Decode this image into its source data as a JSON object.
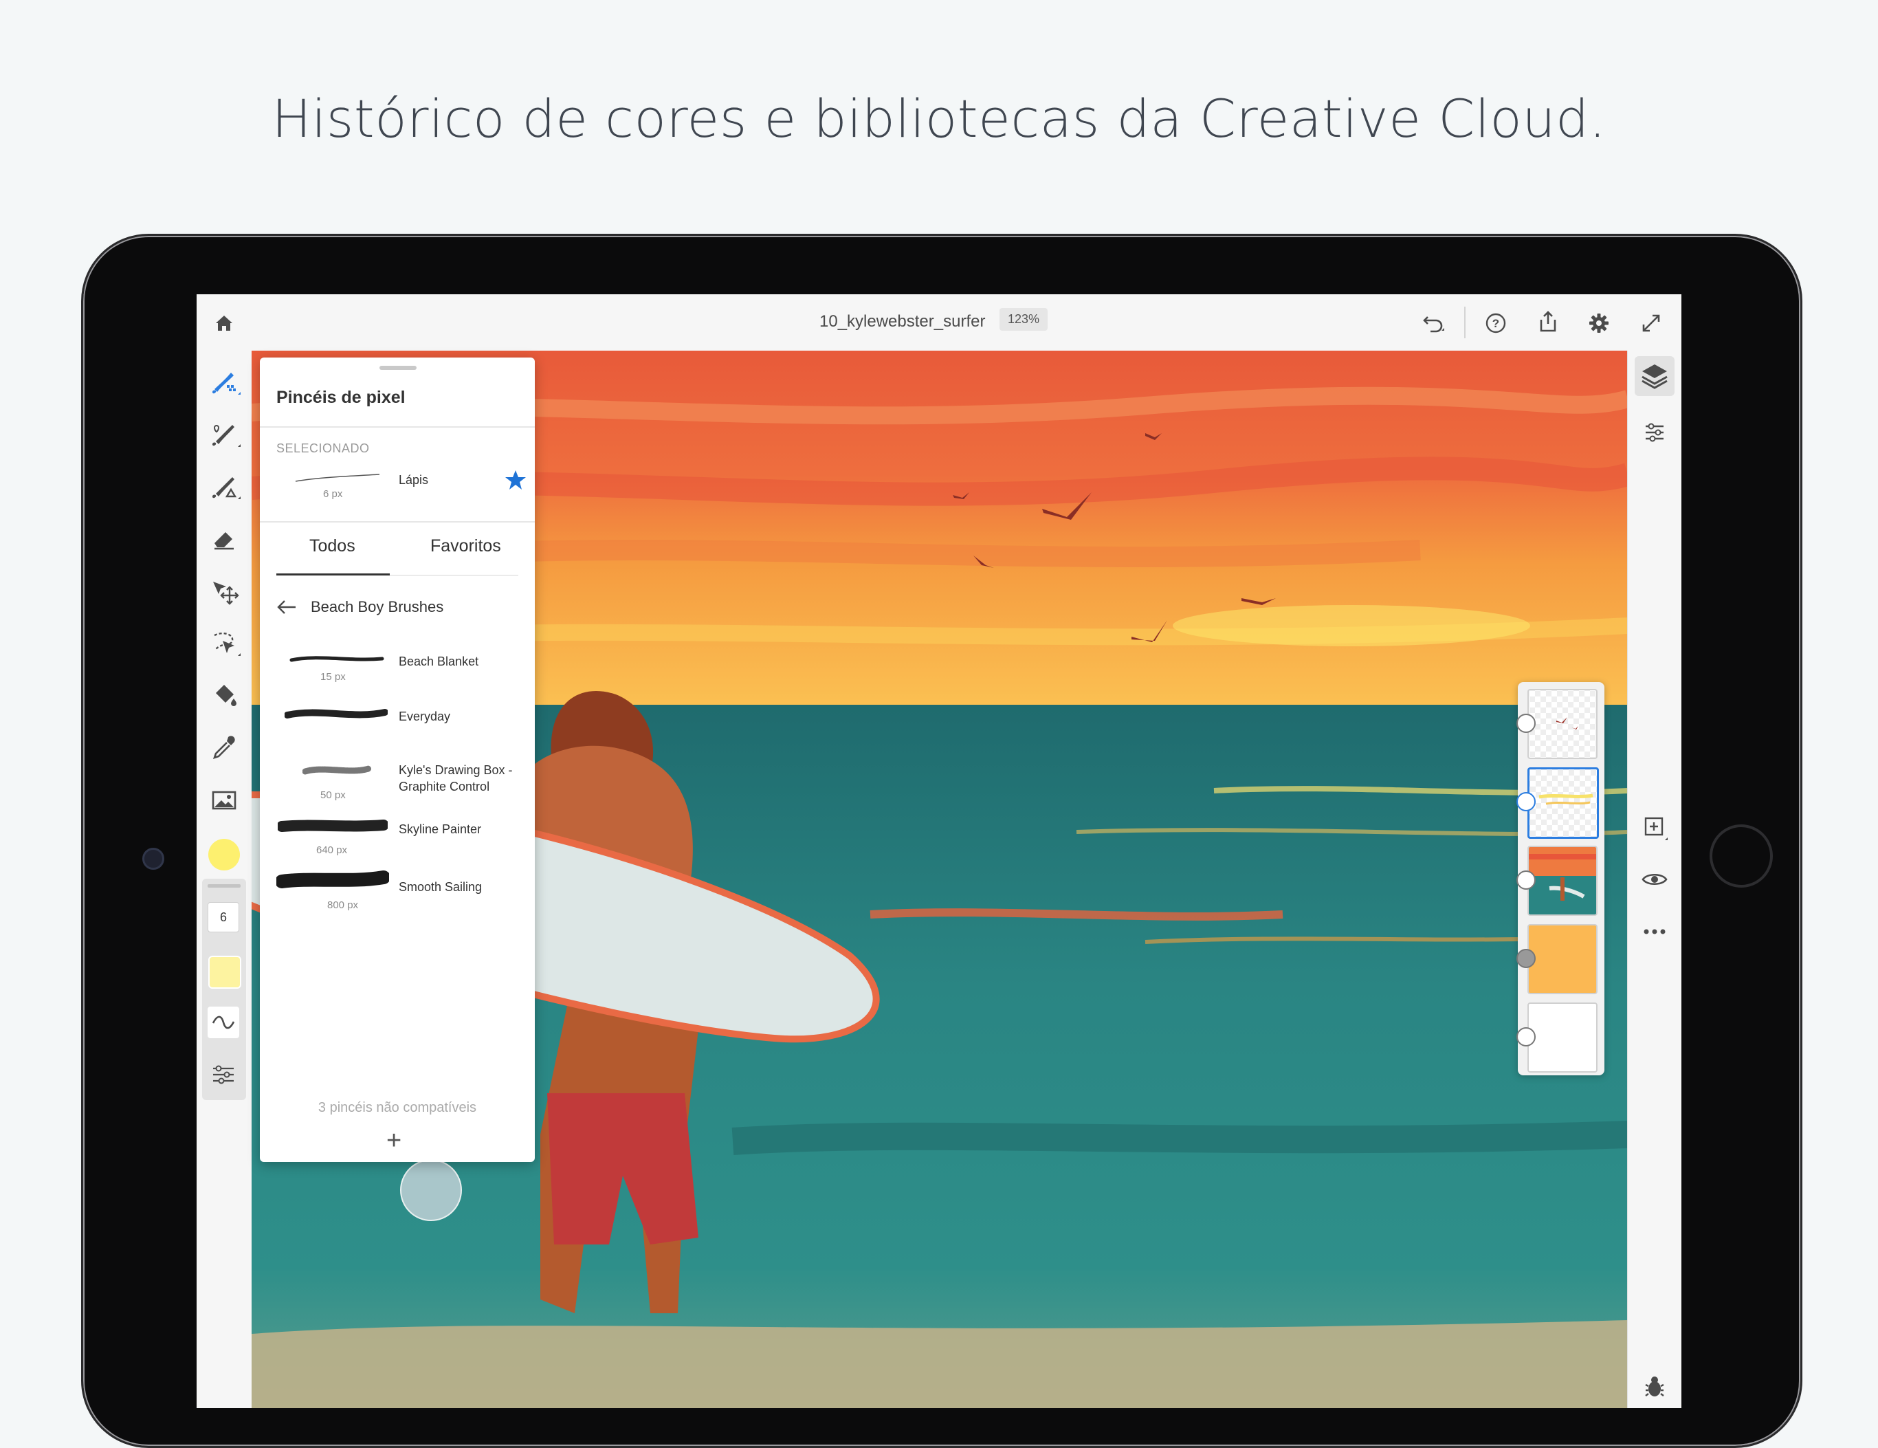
{
  "headline": "Histórico de cores e bibliotecas da Creative Cloud.",
  "topbar": {
    "doc_title": "10_kylewebster_surfer",
    "zoom": "123%",
    "icons": [
      "home-icon",
      "undo-icon",
      "help-icon",
      "share-icon",
      "settings-icon",
      "fullscreen-icon"
    ]
  },
  "leftbar": {
    "tools": [
      "pixel-brush-icon",
      "live-brush-icon",
      "vector-brush-icon",
      "eraser-icon",
      "transform-icon",
      "selection-icon",
      "fill-icon",
      "eyedropper-icon",
      "image-icon"
    ],
    "current_color": "#fdf06f",
    "brush_size": "6",
    "secondary_color": "#fdf3a0"
  },
  "panel": {
    "title": "Pincéis de pixel",
    "selected_label": "SELECIONADO",
    "selected_brush": {
      "name": "Lápis",
      "size": "6 px"
    },
    "tabs": [
      "Todos",
      "Favoritos"
    ],
    "library": "Beach Boy Brushes",
    "brushes": [
      {
        "name": "Beach Blanket",
        "size": "15 px"
      },
      {
        "name": "Everyday",
        "size": ""
      },
      {
        "name": "Kyle's Drawing Box -",
        "name2": "Graphite Control",
        "size": "50 px"
      },
      {
        "name": "Skyline Painter",
        "size": "640 px"
      },
      {
        "name": "Smooth Sailing",
        "size": "800 px"
      }
    ],
    "incompatible": "3 pincéis não compatíveis",
    "add": "+"
  },
  "rightbar": {
    "icons": [
      "layers-icon",
      "properties-icon",
      "add-layer-icon",
      "visibility-icon",
      "more-icon",
      "bug-icon"
    ]
  },
  "colors": {
    "accent": "#2b7de0",
    "star": "#1f73d6"
  }
}
